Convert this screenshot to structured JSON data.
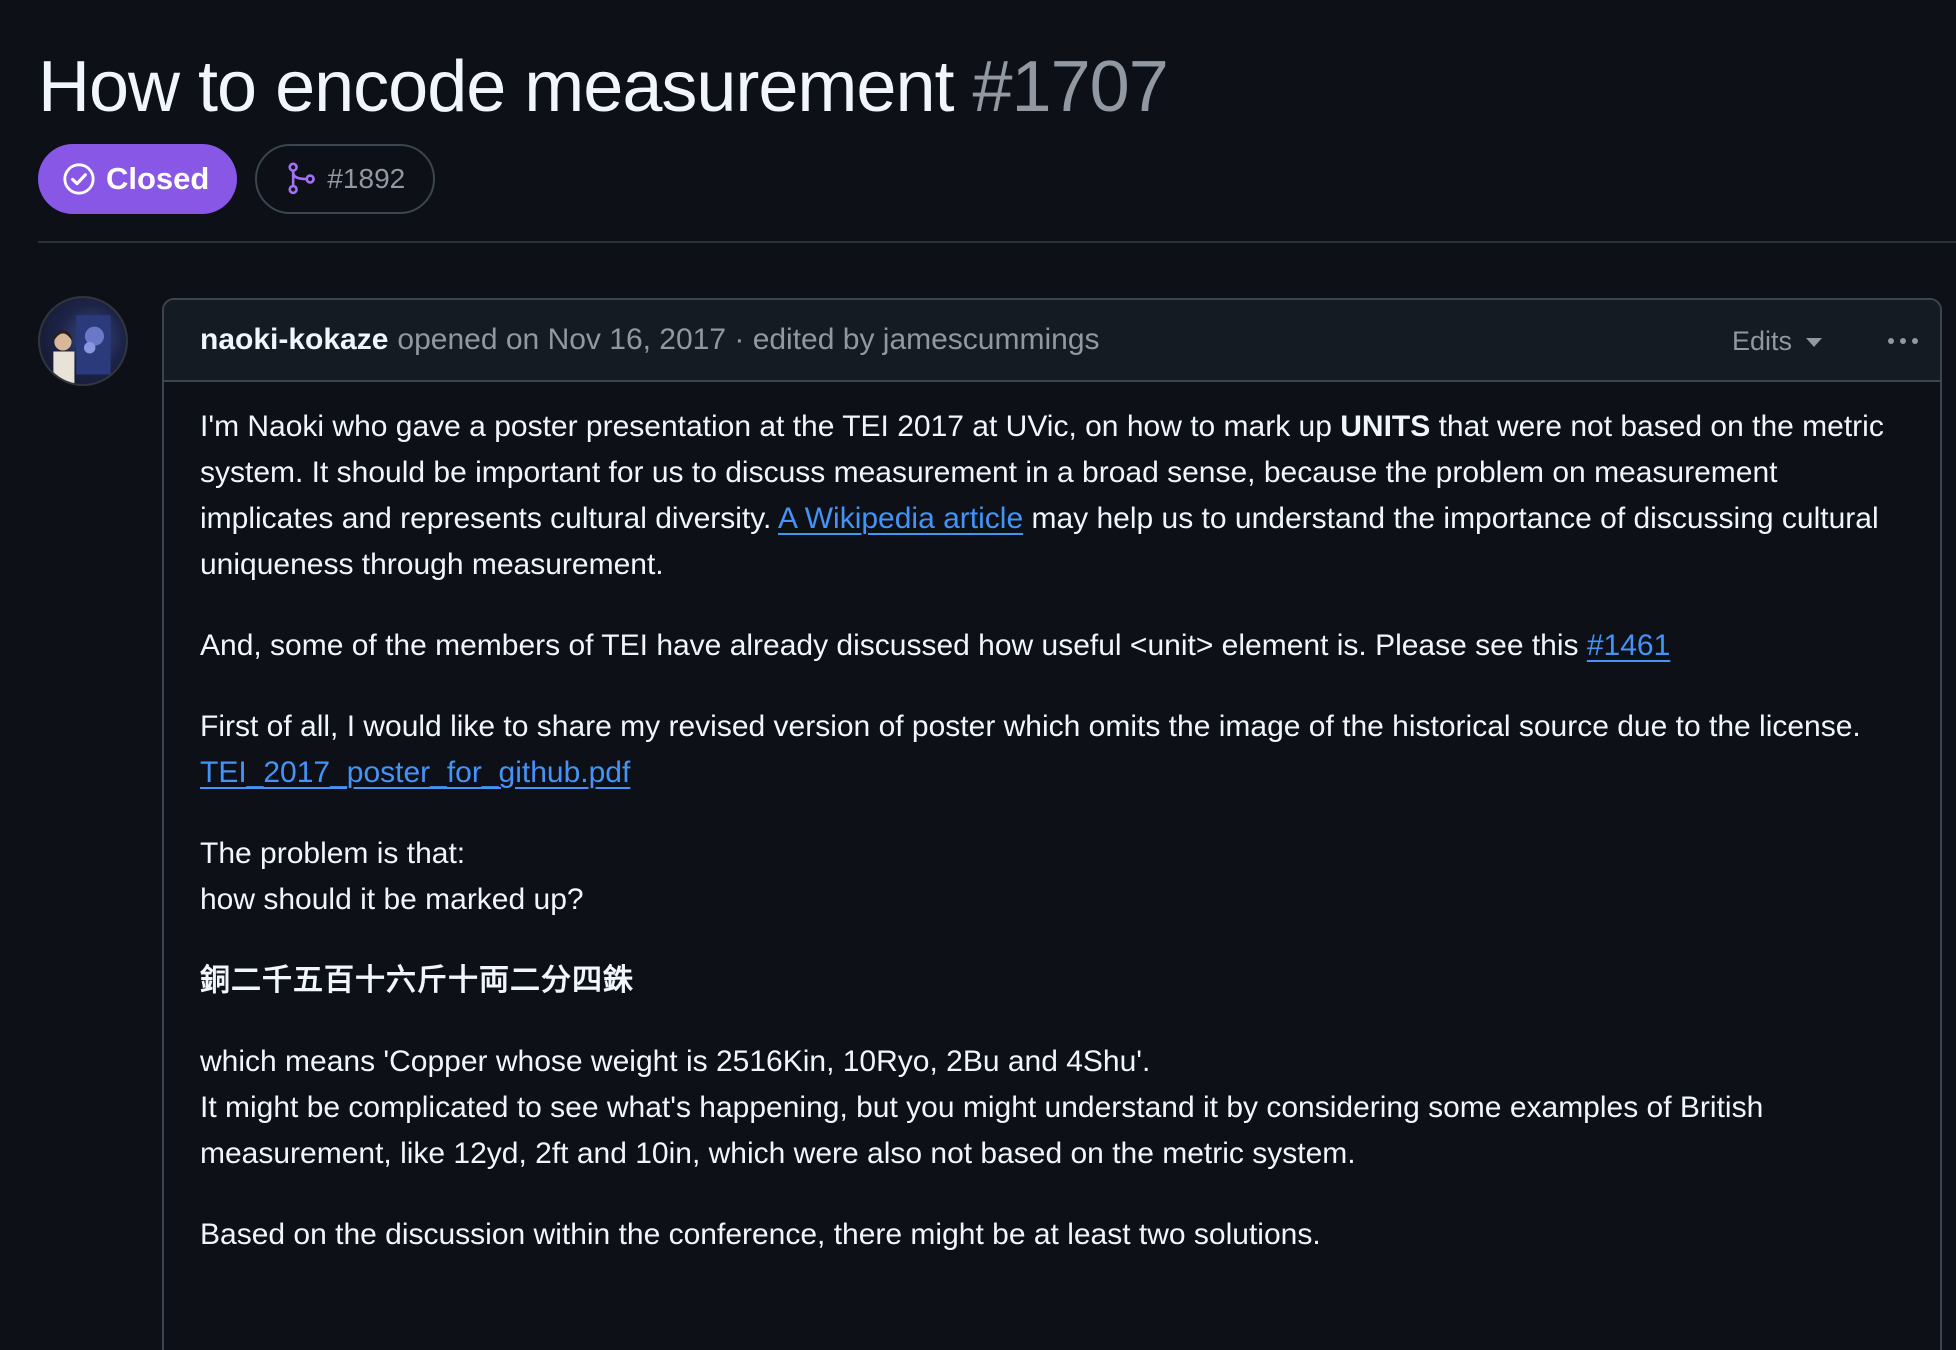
{
  "issue": {
    "title": "How to encode measurement",
    "number": "#1707",
    "state": "Closed",
    "linked_pr": "#1892"
  },
  "comment": {
    "author": "naoki-kokaze",
    "meta": "opened on Nov 16, 2017 · edited by jamescummings",
    "edits_label": "Edits",
    "p1_a": "I'm Naoki who gave a poster presentation at the TEI 2017 at UVic, on how to mark up ",
    "p1_bold": "UNITS",
    "p1_b": " that were not based on the metric system. It should be important for us to discuss measurement in a broad sense, because the problem on measurement implicates and represents cultural diversity. ",
    "p1_link": "A Wikipedia article",
    "p1_c": " may help us to understand the importance of discussing cultural uniqueness through measurement.",
    "p2_a": "And, some of the members of TEI have already discussed how useful <unit> element is. Please see this ",
    "p2_link": "#1461",
    "p3_a": "First of all, I would like to share my revised version of poster which omits the image of the historical source due to the license.",
    "p3_link": "TEI_2017_poster_for_github.pdf",
    "p4_line1": "The problem is that:",
    "p4_line2": "how should it be marked up?",
    "p5_kanji": "銅二千五百十六斤十両二分四銖",
    "p6_line1": "which means 'Copper whose weight is 2516Kin, 10Ryo, 2Bu and 4Shu'.",
    "p6_line2": "It might be complicated to see what's happening, but you might understand it by considering some examples of British measurement, like 12yd, 2ft and 10in, which were also not based on the metric system.",
    "p7": "Based on the discussion within the conference, there might be at least two solutions."
  },
  "colors": {
    "background": "#0d1117",
    "closed_badge": "#8957e5",
    "link": "#4493f8",
    "muted": "#9198a1"
  },
  "icons": [
    "check-circle-icon",
    "git-merge-icon",
    "triangle-down-icon",
    "kebab-horizontal-icon"
  ]
}
